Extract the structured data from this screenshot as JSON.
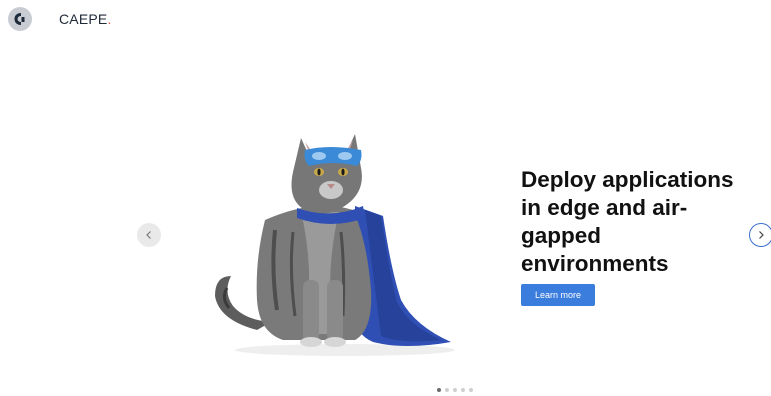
{
  "brand": {
    "name": "CAEPE",
    "dot": ".",
    "logo_icon": "caepe-logo-icon"
  },
  "hero": {
    "headline": "Deploy applications in edge and air-gapped environments",
    "cta_label": "Learn more",
    "image": "superhero-cat-illustration"
  },
  "carousel": {
    "prev_icon": "chevron-left-icon",
    "next_icon": "chevron-right-icon",
    "slide_count": 5,
    "active_index": 0
  },
  "colors": {
    "accent": "#3b7ddd",
    "brand_dot": "#f05a4a",
    "cape": "#2f4fb4"
  }
}
